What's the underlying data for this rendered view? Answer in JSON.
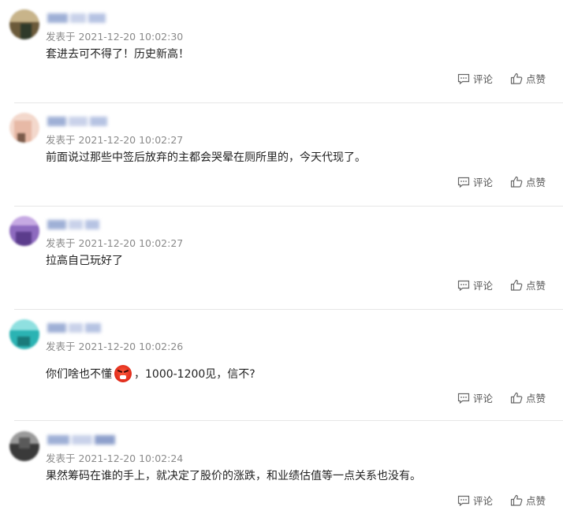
{
  "comments": [
    {
      "time": "发表于 2021-12-20 10:02:30",
      "content": "套进去可不得了！历史新高！",
      "comment_label": "评论",
      "like_label": "点赞",
      "avatar_colors": [
        "#6b5a3a",
        "#c8b48a",
        "#2f3a2a"
      ]
    },
    {
      "time": "发表于 2021-12-20 10:02:27",
      "content": "前面说过那些中签后放弃的主都会哭晕在厕所里的，今天代现了。",
      "comment_label": "评论",
      "like_label": "点赞",
      "avatar_colors": [
        "#e7b9a6",
        "#f3d8cc",
        "#7a5a4a"
      ]
    },
    {
      "time": "发表于 2021-12-20 10:02:27",
      "content": "拉高自己玩好了",
      "comment_label": "评论",
      "like_label": "点赞",
      "avatar_colors": [
        "#8e6bbf",
        "#5b3c8c",
        "#c6a9e3"
      ]
    },
    {
      "time": "发表于 2021-12-20 10:02:26",
      "content_before": "你们啥也不懂",
      "content_after": "，1000-1200见，信不?",
      "comment_label": "评论",
      "like_label": "点赞",
      "avatar_colors": [
        "#2bb3b3",
        "#8fe0e0",
        "#1a7a7a"
      ]
    },
    {
      "time": "发表于 2021-12-20 10:02:24",
      "content": "果然筹码在谁的手上，就决定了股价的涨跌，和业绩估值等一点关系也没有。",
      "comment_label": "评论",
      "like_label": "点赞",
      "avatar_colors": [
        "#3a3a3a",
        "#9a9a9a",
        "#5a5a5a"
      ]
    }
  ]
}
